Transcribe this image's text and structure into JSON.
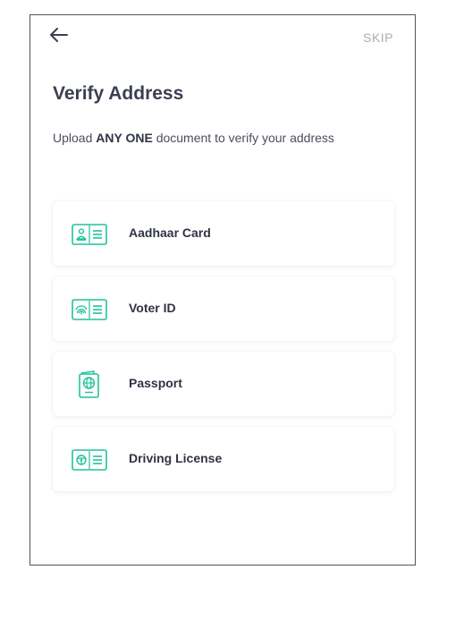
{
  "header": {
    "back_icon": "arrow-left-icon",
    "skip_label": "SKIP"
  },
  "page": {
    "title": "Verify Address",
    "subtitle_prefix": "Upload ",
    "subtitle_emphasis": "ANY ONE",
    "subtitle_suffix": " document to verify your address"
  },
  "documents": [
    {
      "label": "Aadhaar Card",
      "icon": "aadhaar-card-icon"
    },
    {
      "label": "Voter ID",
      "icon": "voter-id-icon"
    },
    {
      "label": "Passport",
      "icon": "passport-icon"
    },
    {
      "label": "Driving License",
      "icon": "driving-license-icon"
    }
  ],
  "colors": {
    "accent": "#21c29a",
    "title_text": "#3b3f51",
    "muted_text": "#a9adb5"
  }
}
